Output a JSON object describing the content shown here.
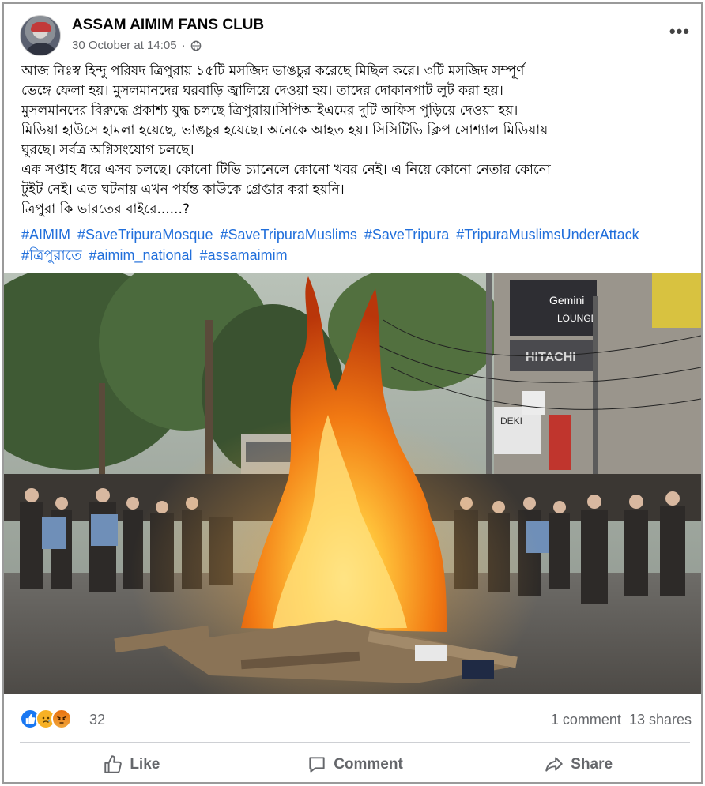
{
  "post": {
    "page_name": "ASSAM AIMIM FANS CLUB",
    "timestamp": "30 October at 14:05",
    "separator": "·",
    "privacy_icon": "globe-icon",
    "more_icon": "more-options-icon",
    "more_label": "•••",
    "text_lines": [
      "আজ নিঃস্ব হিন্দু পরিষদ ত্রিপুরায় ১৫টি মসজিদ ভাঙচুর করেছে মিছিল করে।  ৩টি মসজিদ সম্পূর্ণ",
      "ভেঙ্গে ফেলা হয়। মুসলমানদের ঘরবাড়ি জ্বালিয়ে দেওয়া হয়। তাদের দোকানপাট লুট করা হয়।",
      "মুসলমানদের বিরুদ্ধে প্রকাশ্য যুদ্ধ চলছে ত্রিপুরায়।সিপিআইএমের দুটি অফিস পুড়িয়ে দেওয়া হয়।",
      "মিডিয়া হাউসে হামলা হয়েছে, ভাঙচুর হয়েছে। অনেকে আহত হয়। সিসিটিভি ক্লিপ সোশ্যাল মিডিয়ায়",
      "ঘুরছে। সর্বত্র অগ্নিসংযোগ চলছে।",
      "এক সপ্তাহ ধরে এসব চলছে। কোনো টিভি চ্যানেলে কোনো খবর নেই। এ নিয়ে কোনো নেতার কোনো",
      "টুইট নেই। এত ঘটনায় এখন পর্যন্ত কাউকে গ্রেপ্তার করা হয়নি।",
      "ত্রিপুরা কি ভারতের বাইরে......?"
    ],
    "hashtags_row1": [
      "#AIMIM",
      "#SaveTripuraMosque",
      "#SaveTripuraMuslims",
      "#SaveTripura",
      "#TripuraMuslimsUnderAttack"
    ],
    "hashtags_row2": [
      "#ত্রিপুরাতে",
      "#aimim_national",
      "#assamaimim"
    ],
    "photo_signs": {
      "hotel": "Gemini",
      "lounge": "LOUNGE",
      "brand": "HITACHI",
      "shop": "DEKI"
    }
  },
  "stats": {
    "reaction_count": "32",
    "comments": "1 comment",
    "shares": "13 shares",
    "reactions": [
      "like-reaction-icon",
      "sad-reaction-icon",
      "angry-reaction-icon"
    ]
  },
  "actions": {
    "like": "Like",
    "comment": "Comment",
    "share": "Share"
  },
  "colors": {
    "link": "#216fdb",
    "secondary_text": "#65676b",
    "like_blue": "#1877f2"
  }
}
